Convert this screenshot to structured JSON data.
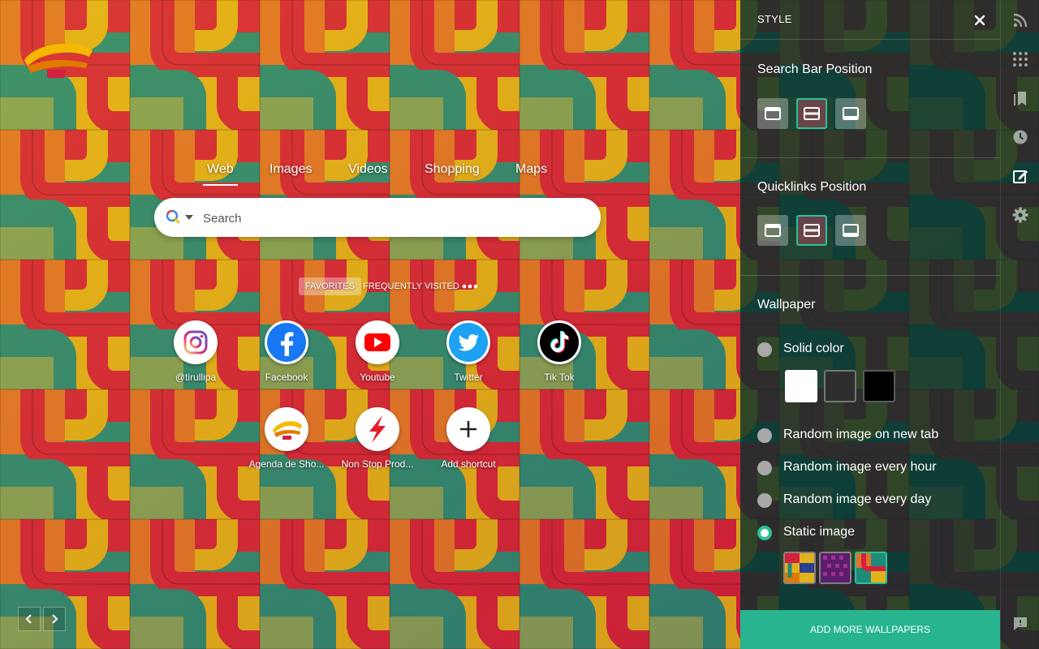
{
  "search": {
    "tabs": [
      "Web",
      "Images",
      "Videos",
      "Shopping",
      "Maps"
    ],
    "active_tab": "Web",
    "placeholder": "Search"
  },
  "quicklinks": {
    "tabs": [
      "FAVORITES",
      "FREQUENTLY VISITED"
    ],
    "active_tab": "FAVORITES",
    "more_icon": "more-horizontal-icon",
    "tiles": [
      {
        "label": "@tirullipa",
        "icon": "instagram-icon"
      },
      {
        "label": "Facebook",
        "icon": "facebook-icon"
      },
      {
        "label": "Youtube",
        "icon": "youtube-icon"
      },
      {
        "label": "Twitter",
        "icon": "twitter-icon"
      },
      {
        "label": "Tik Tok",
        "icon": "tiktok-icon"
      },
      {
        "label": "Agenda de Sho...",
        "icon": "tirullipa-logo-icon"
      },
      {
        "label": "Non Stop Prod...",
        "icon": "lightning-icon"
      },
      {
        "label": "Add shortcut",
        "icon": "plus-icon"
      }
    ]
  },
  "style_panel": {
    "title": "STYLE",
    "search_bar_position": {
      "title": "Search Bar Position",
      "selected": "middle"
    },
    "quicklinks_position": {
      "title": "Quicklinks Position",
      "selected": "middle"
    },
    "wallpaper": {
      "title": "Wallpaper",
      "options": [
        "Solid color",
        "Random image on new tab",
        "Random image every hour",
        "Random image every day",
        "Static image"
      ],
      "selected": "Static image",
      "solid_colors": [
        "#ffffff",
        "#2e2e2e",
        "#000000"
      ],
      "selected_thumbnail": 3
    },
    "add_more_label": "ADD MORE WALLPAPERS"
  },
  "rail_icons": [
    "rss-icon",
    "apps-grid-icon",
    "bookmark-icon",
    "history-clock-icon",
    "style-edit-icon",
    "settings-gear-icon",
    "feedback-icon"
  ],
  "colors": {
    "accent": "#27b48f",
    "panel_bg": "#062e2a",
    "wall_red": "#d4203c",
    "wall_orange": "#e0742a",
    "wall_yellow": "#e2b21c",
    "wall_teal": "#1f8a7a",
    "wall_green": "#7ea35c"
  }
}
